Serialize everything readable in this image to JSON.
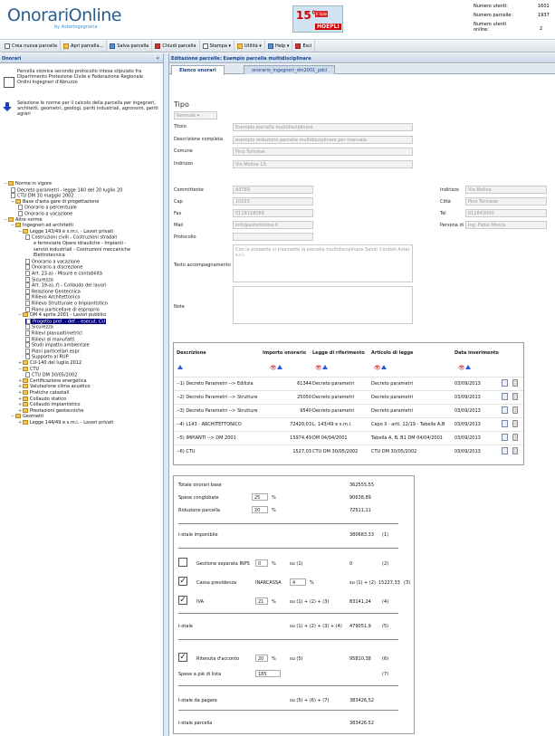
{
  "header": {
    "logo": "OnorariOnline",
    "logo_sub": "by Asteringegneria",
    "banner_num": "15°",
    "banner_sub": "Il Sole",
    "banner_pub": "HOEPLI",
    "stats": [
      {
        "label": "Numero utenti:",
        "value": "1601"
      },
      {
        "label": "Numero parcelle:",
        "value": "1937"
      },
      {
        "label": "Numero utenti online:",
        "value": "2"
      }
    ]
  },
  "toolbar": [
    {
      "label": "Crea nuova parcella",
      "icon": "new-icon"
    },
    {
      "label": "Apri parcella...",
      "icon": "open-icon"
    },
    {
      "label": "Salva parcella",
      "icon": "save-icon"
    },
    {
      "label": "Chiudi parcella",
      "icon": "close-icon"
    },
    {
      "label": "Stampa ▾",
      "icon": "print-icon"
    },
    {
      "label": "Utilità ▾",
      "icon": "tools-icon"
    },
    {
      "label": "Help ▾",
      "icon": "help-icon"
    },
    {
      "label": "Esci",
      "icon": "exit-icon"
    }
  ],
  "left": {
    "title": "Onorari",
    "info1": "Parcella sismica secondo protocollo intesa stipulato fra Dipartimento Protezione Civile e Federazione Regionale Ordini Ingegneri d'Abruzzo",
    "info2": "Selezione le norme per il calcolo della parcella per ingegneri, architetti, geometri, geologi, periti industriali, agronomi, periti agrari",
    "tree": [
      {
        "text": "Norme in vigore",
        "level": 0,
        "kind": "folder",
        "tg": "−"
      },
      {
        "text": "Decreto parametri - legge 140 del 20 luglio 20",
        "level": 1,
        "kind": "doc"
      },
      {
        "text": "CTU DM 30 maggio 2002",
        "level": 1,
        "kind": "doc"
      },
      {
        "text": "Base d'asta gare di progettazione",
        "level": 1,
        "kind": "folder",
        "tg": "−"
      },
      {
        "text": "Onorario a percentuale",
        "level": 2,
        "kind": "doc"
      },
      {
        "text": "Onorario a vacazione",
        "level": 2,
        "kind": "doc"
      },
      {
        "text": "Altre norme",
        "level": 0,
        "kind": "folder",
        "tg": "−"
      },
      {
        "text": "Ingegneri ed architetti",
        "level": 1,
        "kind": "folder",
        "tg": "−"
      },
      {
        "text": "Legge 143/49 e s.m.i. - Lavori privati",
        "level": 2,
        "kind": "folder",
        "tg": "−"
      },
      {
        "text": "Costruzioni civili - Costruzioni stradali",
        "level": 3,
        "kind": "doc"
      },
      {
        "text": "e ferroviarie Opere idrauliche - Impianti -",
        "level": 3,
        "kind": "none"
      },
      {
        "text": "servizi industriali - Costruzioni meccaniche",
        "level": 3,
        "kind": "none"
      },
      {
        "text": "Elettrotecnica",
        "level": 3,
        "kind": "none"
      },
      {
        "text": "Onorario a vacazione",
        "level": 3,
        "kind": "doc"
      },
      {
        "text": "Onorario a discrezione",
        "level": 3,
        "kind": "doc"
      },
      {
        "text": "Art. 23-a) - Misure e contabilità",
        "level": 3,
        "kind": "doc"
      },
      {
        "text": "Sicurezza",
        "level": 3,
        "kind": "doc"
      },
      {
        "text": "Art. 19-a)..f) - Collaudo dei lavori",
        "level": 3,
        "kind": "doc"
      },
      {
        "text": "Relazione Geotecnica",
        "level": 3,
        "kind": "doc"
      },
      {
        "text": "Rilievo Architettonico",
        "level": 3,
        "kind": "doc"
      },
      {
        "text": "Rilievo Strutturale o Impiantistico",
        "level": 3,
        "kind": "doc"
      },
      {
        "text": "Piano particellare di esproprio",
        "level": 3,
        "kind": "doc"
      },
      {
        "text": "DM 4 aprile 2001 - Lavori pubblici",
        "level": 2,
        "kind": "folder",
        "tg": "−"
      },
      {
        "text": "Progetto prel. - def. - esecut. CU",
        "level": 3,
        "kind": "doc",
        "selected": true
      },
      {
        "text": "Sicurezza",
        "level": 3,
        "kind": "doc"
      },
      {
        "text": "Rilievi planoaltimetrici",
        "level": 3,
        "kind": "doc"
      },
      {
        "text": "Rilievi di manufatti",
        "level": 3,
        "kind": "doc"
      },
      {
        "text": "Studi impatto ambientale",
        "level": 3,
        "kind": "doc"
      },
      {
        "text": "Piani particellari espr.",
        "level": 3,
        "kind": "doc"
      },
      {
        "text": "Supporto al RUP",
        "level": 3,
        "kind": "doc"
      },
      {
        "text": "CU-140 del luglio 2012",
        "level": 2,
        "kind": "folder",
        "tg": "+"
      },
      {
        "text": "CTU",
        "level": 2,
        "kind": "folder",
        "tg": "−"
      },
      {
        "text": "CTU DM 30/05/2002",
        "level": 3,
        "kind": "doc"
      },
      {
        "text": "Certificazione energetica",
        "level": 2,
        "kind": "folder",
        "tg": "+"
      },
      {
        "text": "Valutazione clima acustico",
        "level": 2,
        "kind": "folder",
        "tg": "+"
      },
      {
        "text": "Pratiche catastali",
        "level": 2,
        "kind": "folder",
        "tg": "+"
      },
      {
        "text": "Collaudo statico",
        "level": 2,
        "kind": "folder",
        "tg": "+"
      },
      {
        "text": "Collaudo impiantistico",
        "level": 2,
        "kind": "folder",
        "tg": "+"
      },
      {
        "text": "Prestazioni geotecniche",
        "level": 2,
        "kind": "folder",
        "tg": "+"
      },
      {
        "text": "Geometri",
        "level": 1,
        "kind": "folder",
        "tg": "−"
      },
      {
        "text": "Legge 144/49 e s.m.i. - Lavori privati",
        "level": 2,
        "kind": "folder",
        "tg": "+"
      }
    ]
  },
  "main": {
    "title": "Editazione parcelle: Esempio parcella multidisciplinare",
    "tabs": [
      "Elenco onorari",
      "onorario_ingegneri_dm2001_pdcl"
    ],
    "tipo_label": "Tipo",
    "tipo_value": "Normale",
    "fields": {
      "titolo": {
        "label": "Titolo",
        "value": "Esempio parcella multidisciplinare"
      },
      "descrizione": {
        "label": "Descrizione completa",
        "value": "esempio redazione parcella multidisciplinare per manuale"
      },
      "comune": {
        "label": "Comune",
        "value": "Pino Torinese"
      },
      "indirizzo": {
        "label": "Indirizzo",
        "value": "Via Molina 13"
      },
      "committente": {
        "label": "Committente",
        "value": "ASTER"
      },
      "cap": {
        "label": "Cap",
        "value": "10025"
      },
      "fax": {
        "label": "Fax",
        "value": "0118118089"
      },
      "mail": {
        "label": "Mail",
        "value": "info@asteronline.it"
      },
      "protocollo": {
        "label": "Protocollo",
        "value": ""
      },
      "indirizzo_r": {
        "label": "Indirizzo",
        "value": "Via Molina"
      },
      "citta": {
        "label": "Città",
        "value": "Pino Torinese"
      },
      "tel": {
        "label": "Tel",
        "value": "011843000"
      },
      "persona": {
        "label": "Persona di riferimento",
        "value": "ing. Fabio Mosca"
      },
      "testo": {
        "label": "Testo accompagnamento",
        "value": "Con la presente si trasmette la parcella multidisciplinare.Saluti Cordiali Aster s.r.l."
      },
      "note": {
        "label": "Note",
        "value": ""
      }
    },
    "grid": {
      "headers": [
        "Descrizione",
        "Importo onorario",
        "Legge di riferimento",
        "Articolo di legge",
        "Data inserimento"
      ],
      "rows": [
        [
          "--1) Decreto Parametri --> Edilizia",
          "61344",
          "Decreto parametri",
          "Decreto parametri",
          "03/09/2013"
        ],
        [
          "--2) Decreto Parametri --> Strutture",
          "25050",
          "Decreto parametri",
          "Decreto parametri",
          "03/09/2013"
        ],
        [
          "--3) Decreto Parametri --> Strutture",
          "9540",
          "Decreto parametri",
          "Decreto parametri",
          "03/09/2013"
        ],
        [
          "--4) L143 - ARCHITETTONICO",
          "72420,03",
          "L. 143/49 e s.m.i.",
          "Capo II - artt. 12/19 - Tabelle A,B",
          "03/09/2013"
        ],
        [
          "--5) IMPIANTI --> DM 2001",
          "15974,49",
          "DM 04/04/2001",
          "Tabella A, B, B1 DM 04/04/2001",
          "03/09/2013"
        ],
        [
          "--6) CTU",
          "1527,03",
          "CTU DM 30/05/2002",
          "CTU DM 30/05/2002",
          "03/09/2013"
        ]
      ]
    },
    "totals": {
      "totale_onorari_label": "Totale onorari base",
      "totale_onorari": "362555,55",
      "spese_label": "Spese conglobate",
      "spese_pct": "25",
      "spese_val": "90638,89",
      "riduzione_label": "Riduzione parcella",
      "riduzione_pct": "20",
      "riduzione_val": "72511,11",
      "imponibile_label": "I-otale imponibile",
      "imponibile_val": "380683,33",
      "imponibile_ref": "(1)",
      "inps_label": "Gestione separata INPS",
      "inps_pct": "0",
      "inps_su": "su (1)",
      "inps_val": "0",
      "inps_ref": "(2)",
      "cassa_label": "Cassa previdenza",
      "cassa_name": "INARCASSA",
      "cassa_pct": "4",
      "cassa_su": "su (1) + (2)",
      "cassa_val": "15227,33",
      "cassa_ref": "(3)",
      "iva_label": "IVA",
      "iva_pct": "21",
      "iva_su": "su (1) + (2) + (3)",
      "iva_val": "83141,24",
      "iva_ref": "(4)",
      "totale_label": "I-otale",
      "totale_su": "su (1) + (2) + (3) + (4)",
      "totale_val": "479051,9",
      "totale_ref": "(5)",
      "ritenuta_label": "Ritenuta d'acconto",
      "ritenuta_pct": "20",
      "ritenuta_su": "su (5)",
      "ritenuta_val": "95810,38",
      "ritenuta_ref": "(6)",
      "spese_pie_label": "Spese a piè di lista",
      "spese_pie_val": "185",
      "spese_pie_ref": "(7)",
      "pagare_label": "I-otale da pagare",
      "pagare_su": "su (5) + (6) + (7)",
      "pagare_val": "383426,52",
      "parcella_label": "I-otale parcella",
      "parcella_val": "383426,52",
      "pct_sign": "%"
    }
  }
}
